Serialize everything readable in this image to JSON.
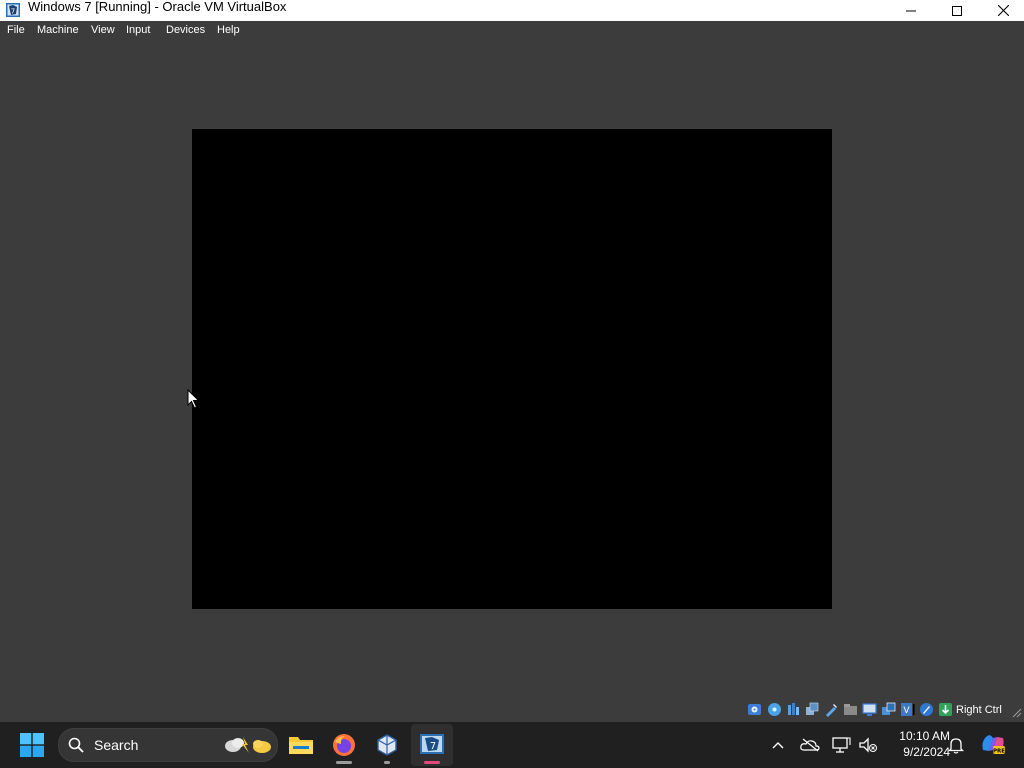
{
  "window": {
    "title": "Windows 7 [Running] - Oracle VM VirtualBox",
    "controls": [
      "minimize",
      "maximize",
      "close"
    ]
  },
  "menu": {
    "items": [
      "File",
      "Machine",
      "View",
      "Input",
      "Devices",
      "Help"
    ]
  },
  "guest_screen": {
    "background": "#000000"
  },
  "statusbar": {
    "icons": [
      "hard-disk-icon",
      "optical-drive-icon",
      "audio-icon",
      "network-icon",
      "usb-icon",
      "shared-folders-icon",
      "display-icon",
      "video-capture-icon",
      "virtualization-icon",
      "mouse-integration-icon",
      "keyboard-icon"
    ],
    "host_key": "Right Ctrl"
  },
  "taskbar": {
    "search_placeholder": "Search",
    "pinned": [
      "start-icon",
      "file-explorer-icon",
      "firefox-icon",
      "virtualbox-icon",
      "virtualbox-vm-icon"
    ],
    "clock": {
      "time": "10:10 AM",
      "date": "9/2/2024"
    },
    "tray": [
      "show-hidden-icons",
      "onedrive-icon",
      "network-icon",
      "volume-muted-icon",
      "notifications-icon",
      "copilot-icon"
    ]
  },
  "colors": {
    "window_bg": "#3c3c3c",
    "titlebar_bg": "#ffffff",
    "taskbar_bg": "#202020",
    "accent": "#0078d4",
    "active_indicator": "#e04a7b"
  }
}
